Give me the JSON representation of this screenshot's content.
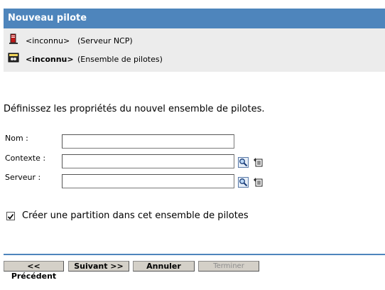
{
  "header": {
    "title": "Nouveau pilote"
  },
  "info": {
    "server": {
      "name": "<inconnu>",
      "type": "(Serveur NCP)",
      "icon": "server-icon"
    },
    "driverset": {
      "name": "<inconnu>",
      "type": "(Ensemble de pilotes)",
      "icon": "driverset-icon"
    }
  },
  "intro": "Définissez les propriétés du nouvel ensemble de pilotes.",
  "form": {
    "name_label": "Nom :",
    "name_value": "",
    "context_label": "Contexte :",
    "context_value": "",
    "server_label": "Serveur :",
    "server_value": ""
  },
  "checkbox": {
    "label": "Créer une partition dans cet ensemble de pilotes",
    "checked": true
  },
  "buttons": {
    "previous": "<< Précédent",
    "next": "Suivant >>",
    "cancel": "Annuler",
    "finish": "Terminer"
  },
  "colors": {
    "header": "#4e85bc",
    "panel": "#ececec",
    "button": "#d4d0c8"
  }
}
